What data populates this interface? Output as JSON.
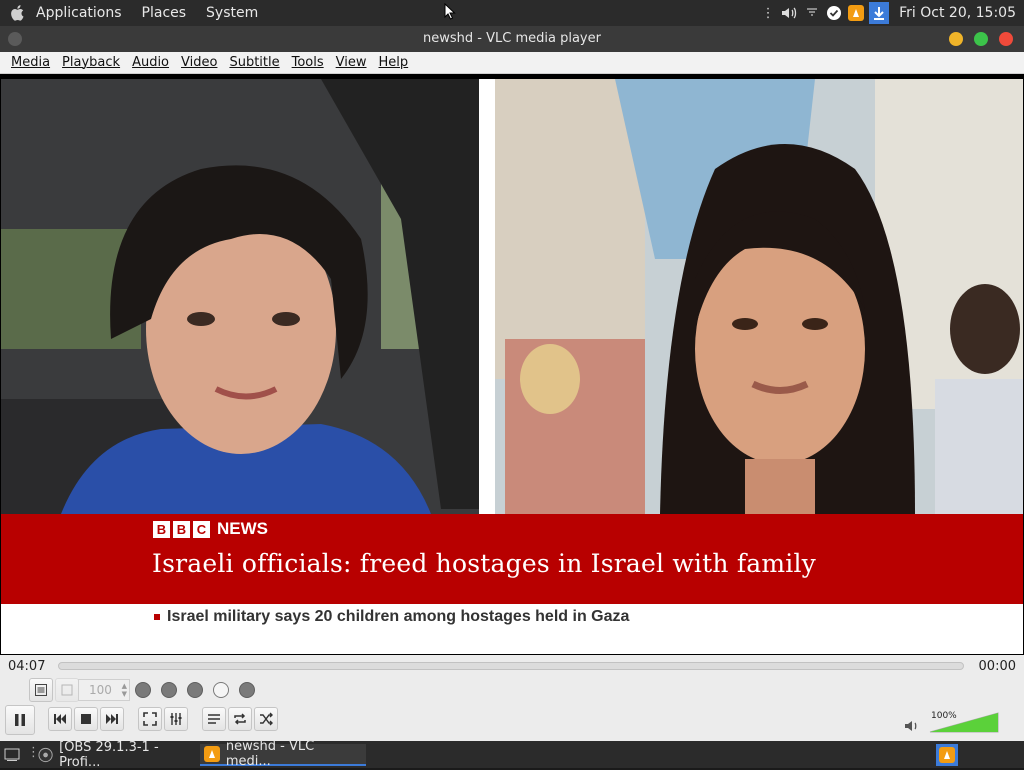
{
  "top_panel": {
    "menus": [
      "Applications",
      "Places",
      "System"
    ],
    "clock": "Fri Oct 20, 15:05"
  },
  "window": {
    "title": "newshd - VLC media player"
  },
  "menubar": [
    "Media",
    "Playback",
    "Audio",
    "Video",
    "Subtitle",
    "Tools",
    "View",
    "Help"
  ],
  "video": {
    "bbc_letters": [
      "B",
      "B",
      "C"
    ],
    "bbc_news_label": "NEWS",
    "headline": "Israeli officials: freed hostages in Israel with family",
    "ticker": "Israel military says 20 children among hostages held in Gaza"
  },
  "controls": {
    "elapsed": "04:07",
    "total": "00:00",
    "seek_progress": 0,
    "speed_value": "100",
    "volume_label": "100%",
    "volume_level": 1.0
  },
  "taskbar": {
    "tasks": [
      "[OBS 29.1.3-1 - Profi...",
      "newshd - VLC medi..."
    ]
  },
  "colors": {
    "bbc_red": "#b80000",
    "accent_blue": "#3c7bd9",
    "vlc_orange": "#f39c12"
  },
  "icons": {
    "top_left": "apple-logo-icon",
    "tray": [
      "dots-icon",
      "volume-icon",
      "network-icon",
      "check-icon",
      "vlc-tray-icon",
      "download-icon"
    ]
  }
}
